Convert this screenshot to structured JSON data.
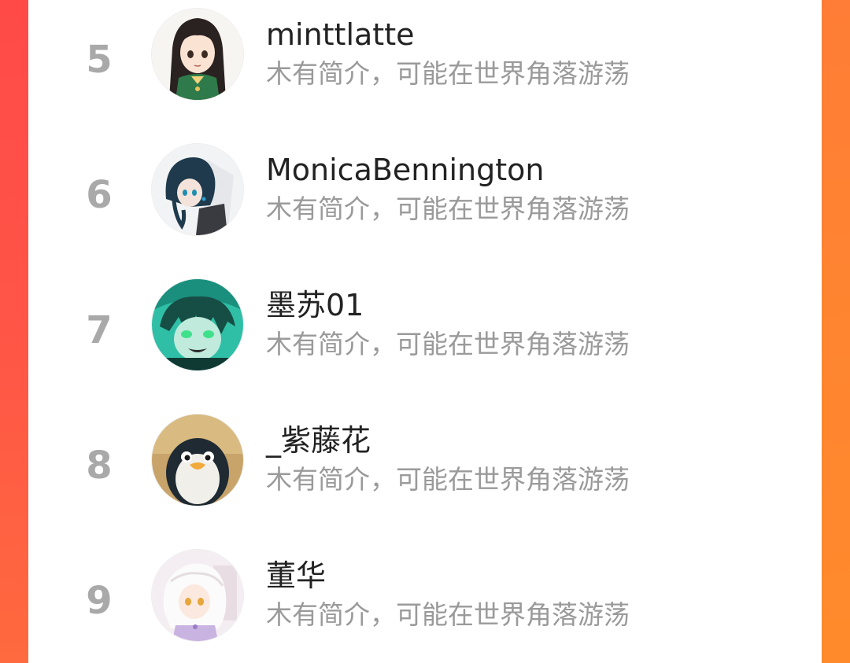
{
  "ranking": {
    "items": [
      {
        "rank": "5",
        "name": "minttlatte",
        "bio": "木有简介，可能在世界角落游荡",
        "avatar_icon": "avatar-girl-green-jacket"
      },
      {
        "rank": "6",
        "name": "MonicaBennington",
        "bio": "木有简介，可能在世界角落游荡",
        "avatar_icon": "avatar-braided-character"
      },
      {
        "rank": "7",
        "name": "墨苏01",
        "bio": "木有简介，可能在世界角落游荡",
        "avatar_icon": "avatar-teal-haired-character"
      },
      {
        "rank": "8",
        "name": "_紫藤花",
        "bio": "木有简介，可能在世界角落游荡",
        "avatar_icon": "avatar-penguin"
      },
      {
        "rank": "9",
        "name": "董华",
        "bio": "木有简介，可能在世界角落游荡",
        "avatar_icon": "avatar-white-haired-girl"
      }
    ]
  },
  "colors": {
    "rank_text": "#a9a9a9",
    "name_text": "#222222",
    "bio_text": "#9a9a9a",
    "frame_left": "#ff4a48",
    "frame_right": "#ff8530"
  }
}
